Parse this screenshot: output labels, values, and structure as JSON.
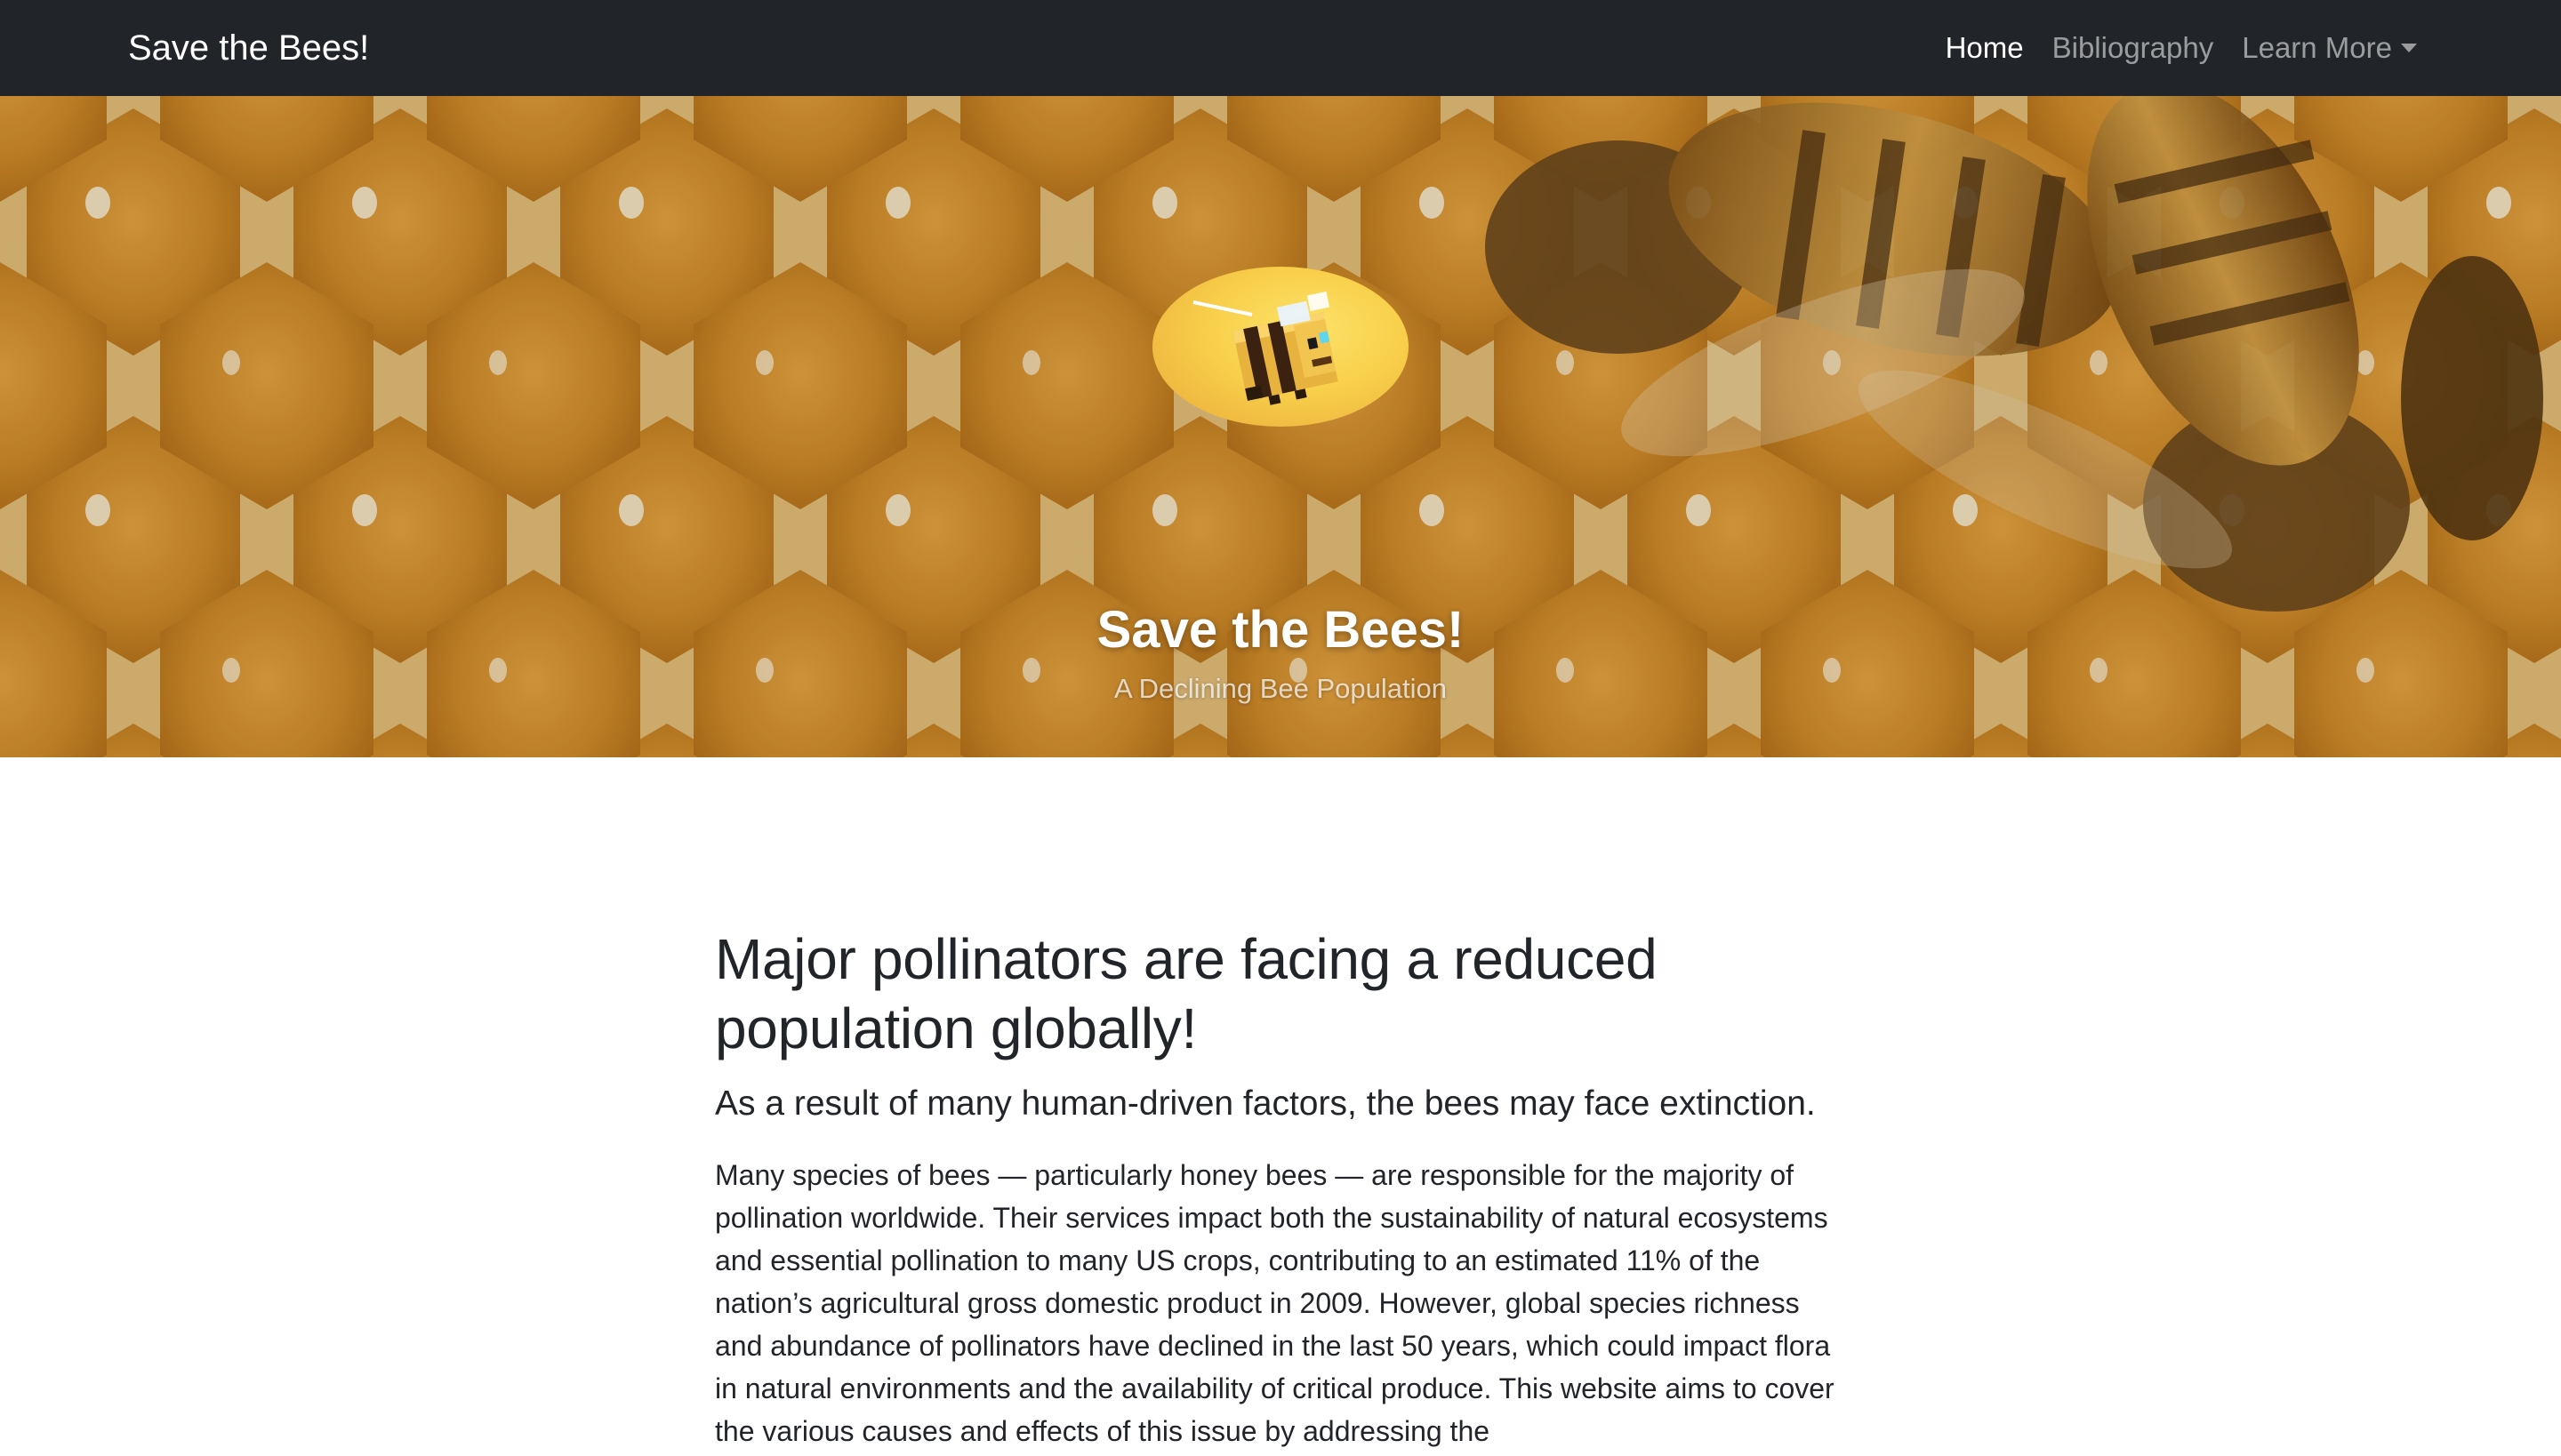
{
  "navbar": {
    "brand": "Save the Bees!",
    "links": [
      {
        "label": "Home",
        "active": true
      },
      {
        "label": "Bibliography",
        "active": false
      },
      {
        "label": "Learn More",
        "active": false,
        "dropdown": true
      }
    ]
  },
  "hero": {
    "title": "Save the Bees!",
    "subtitle": "A Declining Bee Population",
    "background": "honeycomb-with-bees-photo",
    "logo": "pixel-bee-icon"
  },
  "main": {
    "headline": "Major pollinators are facing a reduced population globally!",
    "lead": "As a result of many human-driven factors, the bees may face extinction.",
    "paragraph": "Many species of bees — particularly honey bees — are responsible for the majority of pollination worldwide. Their services impact both the sustainability of natural ecosystems and essential pollination to many US crops, contributing to an estimated 11% of the nation’s agricultural gross domestic product in 2009. However, global species richness and abundance of pollinators have declined in the last 50 years, which could impact flora in natural environments and the availability of critical produce. This website aims to cover the various causes and effects of this issue by addressing the"
  },
  "colors": {
    "navbar_bg": "#212529",
    "nav_active": "#ffffff",
    "nav_inactive": "rgba(255,255,255,0.55)",
    "text": "#212529",
    "honey": "#c98a22"
  }
}
